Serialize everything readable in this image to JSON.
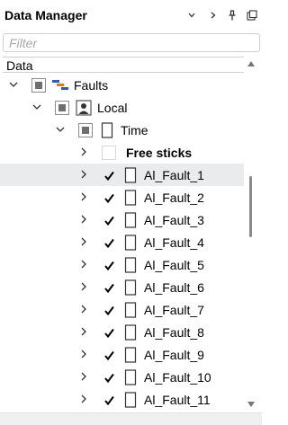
{
  "panel": {
    "title": "Data Manager"
  },
  "titlebar": {
    "buttons": [
      {
        "name": "dropdown-button",
        "glyph": "⌄"
      },
      {
        "name": "expand-button",
        "glyph": ">"
      },
      {
        "name": "pin-button",
        "glyph": "📌"
      },
      {
        "name": "float-button",
        "glyph": "⧉"
      }
    ]
  },
  "filter": {
    "placeholder": "Filter",
    "value": ""
  },
  "columns": {
    "header": "Data"
  },
  "tree": {
    "rows": [
      {
        "level": 0,
        "label": "Faults",
        "expanded": true,
        "check": "partial",
        "icon": "faults-icon"
      },
      {
        "level": 1,
        "label": "Local",
        "expanded": true,
        "check": "partial",
        "icon": "person-icon"
      },
      {
        "level": 2,
        "label": "Time",
        "expanded": true,
        "check": "partial",
        "icon": "document-icon"
      },
      {
        "level": 3,
        "label": "Free sticks",
        "expanded": false,
        "check": "empty",
        "icon": "none",
        "bold": true
      },
      {
        "level": 3,
        "label": "Al_Fault_1",
        "expanded": false,
        "check": "checked",
        "icon": "document-icon",
        "selected": true
      },
      {
        "level": 3,
        "label": "Al_Fault_2",
        "expanded": false,
        "check": "checked",
        "icon": "document-icon"
      },
      {
        "level": 3,
        "label": "Al_Fault_3",
        "expanded": false,
        "check": "checked",
        "icon": "document-icon"
      },
      {
        "level": 3,
        "label": "Al_Fault_4",
        "expanded": false,
        "check": "checked",
        "icon": "document-icon"
      },
      {
        "level": 3,
        "label": "Al_Fault_5",
        "expanded": false,
        "check": "checked",
        "icon": "document-icon"
      },
      {
        "level": 3,
        "label": "Al_Fault_6",
        "expanded": false,
        "check": "checked",
        "icon": "document-icon"
      },
      {
        "level": 3,
        "label": "Al_Fault_7",
        "expanded": false,
        "check": "checked",
        "icon": "document-icon"
      },
      {
        "level": 3,
        "label": "Al_Fault_8",
        "expanded": false,
        "check": "checked",
        "icon": "document-icon"
      },
      {
        "level": 3,
        "label": "Al_Fault_9",
        "expanded": false,
        "check": "checked",
        "icon": "document-icon"
      },
      {
        "level": 3,
        "label": "Al_Fault_10",
        "expanded": false,
        "check": "checked",
        "icon": "document-icon"
      },
      {
        "level": 3,
        "label": "Al_Fault_11",
        "expanded": false,
        "check": "checked",
        "icon": "document-icon"
      }
    ]
  },
  "colors": {
    "selected_row": "#e9ebed",
    "fault_icon_orange": "#e8731f",
    "fault_icon_blue": "#2f5fa8",
    "scroll_thumb": "#8a8a8a"
  }
}
